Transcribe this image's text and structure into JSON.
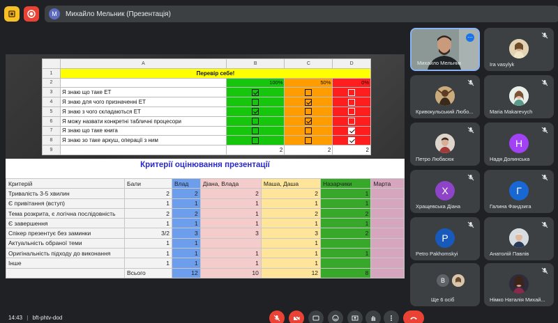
{
  "meeting": {
    "presenter_label": "Михайло Мельник (Презентація)",
    "presenter_initial": "M"
  },
  "sheet1": {
    "col_headers": [
      "A",
      "B",
      "C",
      "D"
    ],
    "title": "Перевір себе!",
    "percents": [
      "100%",
      "50%",
      "0%"
    ],
    "rows": [
      {
        "num": "3",
        "text": "Я знаю що таке ЕТ",
        "checks": [
          true,
          false,
          false
        ]
      },
      {
        "num": "4",
        "text": "Я знаю для чого призначенні ЕТ",
        "checks": [
          false,
          true,
          false
        ]
      },
      {
        "num": "5",
        "text": "Я знаю з чого складаються ЕТ",
        "checks": [
          true,
          false,
          false
        ]
      },
      {
        "num": "6",
        "text": "Я можу назвати конкретні табличні процесори",
        "checks": [
          false,
          true,
          false
        ]
      },
      {
        "num": "7",
        "text": "Я знаю що таке книга",
        "checks": [
          false,
          false,
          true
        ]
      },
      {
        "num": "8",
        "text": "Я знаю зо таке аркуш, операції з ним",
        "checks": [
          false,
          false,
          true
        ]
      }
    ],
    "sums": [
      "2",
      "2",
      "2"
    ],
    "row_nums": {
      "r1": "1",
      "r2": "2",
      "r9": "9"
    }
  },
  "sheet2": {
    "title": "Критерії оцінювання презентації",
    "headers": [
      "Критерій",
      "Бали",
      "Влад",
      "Діана, Влада",
      "Маша, Даша",
      "Назарчики",
      "Марта"
    ],
    "rows": [
      [
        "Тривалість 3-5 хвилин",
        "2",
        "2",
        "2",
        "2",
        "1",
        ""
      ],
      [
        "Є привітання (вступ)",
        "1",
        "1",
        "1",
        "1",
        "1",
        ""
      ],
      [
        "Тема розкрита, є логічна послідовність",
        "2",
        "2",
        "1",
        "2",
        "2",
        ""
      ],
      [
        "Є завершення",
        "1",
        "1",
        "1",
        "1",
        "1",
        ""
      ],
      [
        "Спікер презентує без заминки",
        "3/2",
        "3",
        "3",
        "3",
        "2",
        ""
      ],
      [
        "Актуальність обраної теми",
        "1",
        "1",
        "",
        "1",
        "",
        ""
      ],
      [
        "Оригінальність підходу до виконання",
        "1",
        "1",
        "1",
        "1",
        "1",
        ""
      ],
      [
        "Інше",
        "1",
        "1",
        "1",
        "1",
        "",
        ""
      ]
    ],
    "total_label": "Всього",
    "totals": [
      "12",
      "10",
      "12",
      "8",
      ""
    ]
  },
  "participants": [
    {
      "name": "Михайло Мельник",
      "self": true
    },
    {
      "name": "Ira vasylyk"
    },
    {
      "name": "Кривокульський Любо..."
    },
    {
      "name": "Maria Makarevych"
    },
    {
      "name": "Петро Любасюк"
    },
    {
      "name": "Надя Долинська",
      "initial": "Н",
      "color": "#a142f4"
    },
    {
      "name": "Хращевська Діана",
      "initial": "Х",
      "color": "#8e44c9"
    },
    {
      "name": "Галина Фандзига",
      "initial": "Г",
      "color": "#1967d2"
    },
    {
      "name": "Petro Pakhomskyi",
      "initial": "P",
      "color": "#185abc"
    },
    {
      "name": "Анатолій Павлів"
    },
    {
      "name": "Ще 6 осіб",
      "initial": "В"
    },
    {
      "name": "Німко Наталія Михай..."
    }
  ],
  "bottom": {
    "time": "14:43",
    "separator": "|",
    "code": "bft-phtv-dod"
  },
  "colors": {
    "accent_blue": "#8ab4f8",
    "danger_red": "#ea4335"
  }
}
